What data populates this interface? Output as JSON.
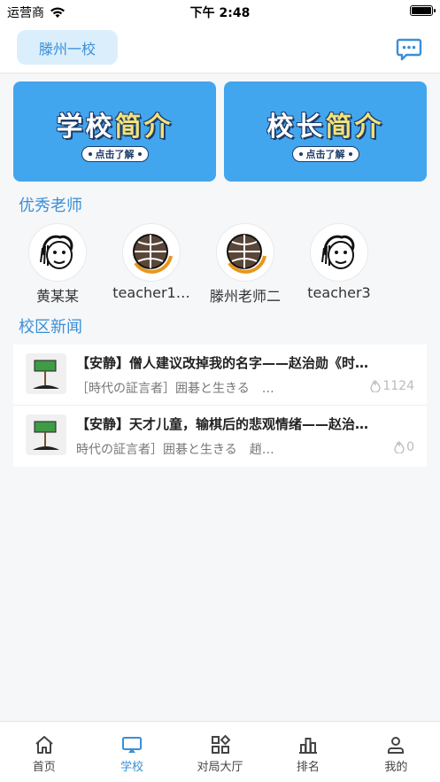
{
  "status": {
    "carrier": "运营商",
    "time": "下午 2:48",
    "battery_level": 1.0
  },
  "header": {
    "school_name": "滕州一校",
    "chat_icon": "chat-bubble-icon"
  },
  "banners": [
    {
      "title_main": "学校",
      "title_accent": "简介",
      "cta": "点击了解"
    },
    {
      "title_main": "校长",
      "title_accent": "简介",
      "cta": "点击了解"
    }
  ],
  "sections": {
    "teachers_title": "优秀老师",
    "news_title": "校区新闻"
  },
  "teachers": [
    {
      "name": "黄某某",
      "avatar": "cartoon-face-avatar"
    },
    {
      "name": "teacher1…",
      "avatar": "go-stone-avatar"
    },
    {
      "name": "滕州老师二",
      "avatar": "go-stone-avatar"
    },
    {
      "name": "teacher3",
      "avatar": "cartoon-face-avatar"
    }
  ],
  "news": [
    {
      "title": "【安静】僧人建议改掉我的名字——赵治勋《时…",
      "subtitle": "［時代の証言者］囲碁と生きる　…",
      "views": "1124",
      "thumb": "sign-holder-icon"
    },
    {
      "title": "【安静】天才儿童，输棋后的悲观情绪——赵治…",
      "subtitle": "時代の証言者］囲碁と生きる　趙…",
      "views": "0",
      "thumb": "sign-holder-icon"
    }
  ],
  "tabs": [
    {
      "label": "首页",
      "icon": "home-icon",
      "active": false
    },
    {
      "label": "学校",
      "icon": "school-monitor-icon",
      "active": true
    },
    {
      "label": "对局大厅",
      "icon": "grid-icon",
      "active": false
    },
    {
      "label": "排名",
      "icon": "ranking-icon",
      "active": false
    },
    {
      "label": "我的",
      "icon": "user-icon",
      "active": false
    }
  ],
  "colors": {
    "accent": "#3a8fd7",
    "banner": "#42a6ee",
    "pill_bg": "#dbeefb"
  }
}
